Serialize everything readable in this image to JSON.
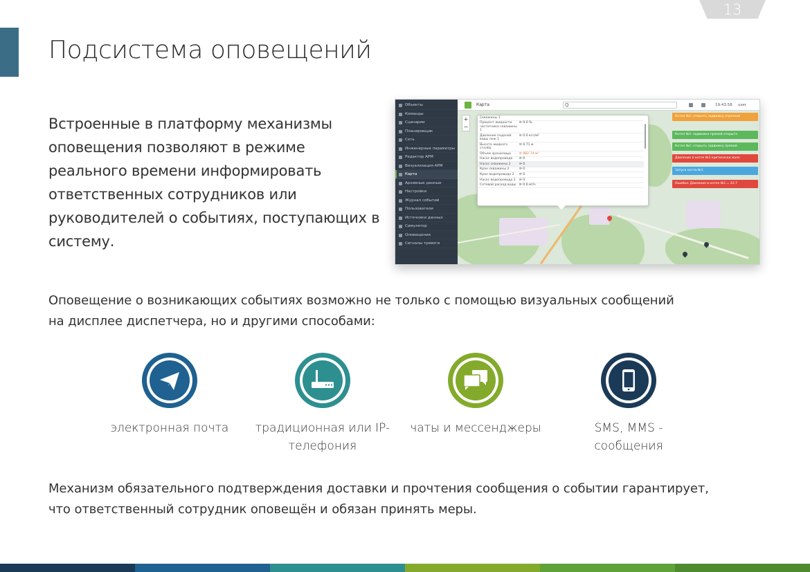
{
  "page": {
    "number": "13",
    "title": "Подсистема оповещений",
    "intro": "Встроенные в платформу механизмы оповещения позволяют в режиме реального времени информировать ответственных сотрудников или руководителей о событиях, поступающих в систему.",
    "lead": "Оповещение о возникающих событиях возможно не только с помощью визуальных сообщений на дисплее диспетчера, но и другими способами:",
    "footer": "Механизм обязательного подтверждения доставки и прочтения сообщения о событии гарантирует, что ответственный сотрудник оповещён и обязан принять меры."
  },
  "screenshot": {
    "sidebar": [
      "Объекты",
      "Команды",
      "Сценарии",
      "Планировщик",
      "Сеть",
      "Инженерные параметры",
      "Редактор АРМ",
      "Визуализация АРМ",
      "Карта",
      "Архивные данные",
      "Настройки",
      "Журнал событий",
      "Пользователи",
      "Источники данных",
      "Симулятор",
      "Оповещения",
      "Сигналы тревоги"
    ],
    "active_index": 8,
    "top": {
      "title": "Карта",
      "search": "Q",
      "time": "19:43:58",
      "user": "user"
    },
    "zoom": {
      "plus": "+",
      "minus": "−"
    },
    "popup_rows": [
      {
        "label": "Скважины 1",
        "value": ""
      },
      {
        "label": "Процент жидкости частотника скважины 1",
        "value": "9.0 %"
      },
      {
        "label": "Давление подачей воды пож 1",
        "value": "0.0 кгс/м²"
      },
      {
        "label": "Высота жидкого столба",
        "value": "0.71 м"
      },
      {
        "label": "Объем хранилища",
        "value": "982.74 м³",
        "warn": true
      },
      {
        "label": "Насос водопровода",
        "value": "0"
      },
      {
        "label": "Насос скважины 2",
        "value": "0",
        "hl": true
      },
      {
        "label": "Кран скважины 2",
        "value": "0"
      },
      {
        "label": "Кран водопровода 2",
        "value": "0"
      },
      {
        "label": "Насос водопровода 2",
        "value": "0"
      },
      {
        "label": "Сетевой расход воды",
        "value": "0.0 м³/ч"
      }
    ],
    "alerts": [
      {
        "text": "Котел №1: открыть задвижку отрезной",
        "color": "#f0a13a"
      },
      {
        "text": "Котел №1: задвижка прямой открыта",
        "color": "#5cb85c"
      },
      {
        "text": "Котел №1: открыть задвижку прямой",
        "color": "#5cb85c"
      },
      {
        "text": "Давление в котле №1 критически мало",
        "color": "#e0483d"
      },
      {
        "text": "Запуск котла №1",
        "color": "#4aa8df"
      },
      {
        "text": "Ошибка: Давление в котле №1 = 22.7",
        "color": "#e0483d"
      }
    ]
  },
  "channels": [
    {
      "label": "электронная почта",
      "icon": "paper-plane-icon",
      "color": "#1f6190"
    },
    {
      "label": "традиционная или IP-телефония",
      "icon": "router-icon",
      "color": "#2e8f91"
    },
    {
      "label": "чаты и мессенджеры",
      "icon": "chat-bubbles-icon",
      "color": "#84aa2b"
    },
    {
      "label": "SMS, MMS - сообщения",
      "icon": "smartphone-icon",
      "color": "#1b3a57"
    }
  ],
  "colors": {
    "accent": "#3b6e86",
    "page_number_bg": "#d9d9d9",
    "stripe": [
      "#1b3a57",
      "#1f6190",
      "#2e8f91",
      "#84aa2b",
      "#5fa237",
      "#4f8a2f"
    ]
  }
}
